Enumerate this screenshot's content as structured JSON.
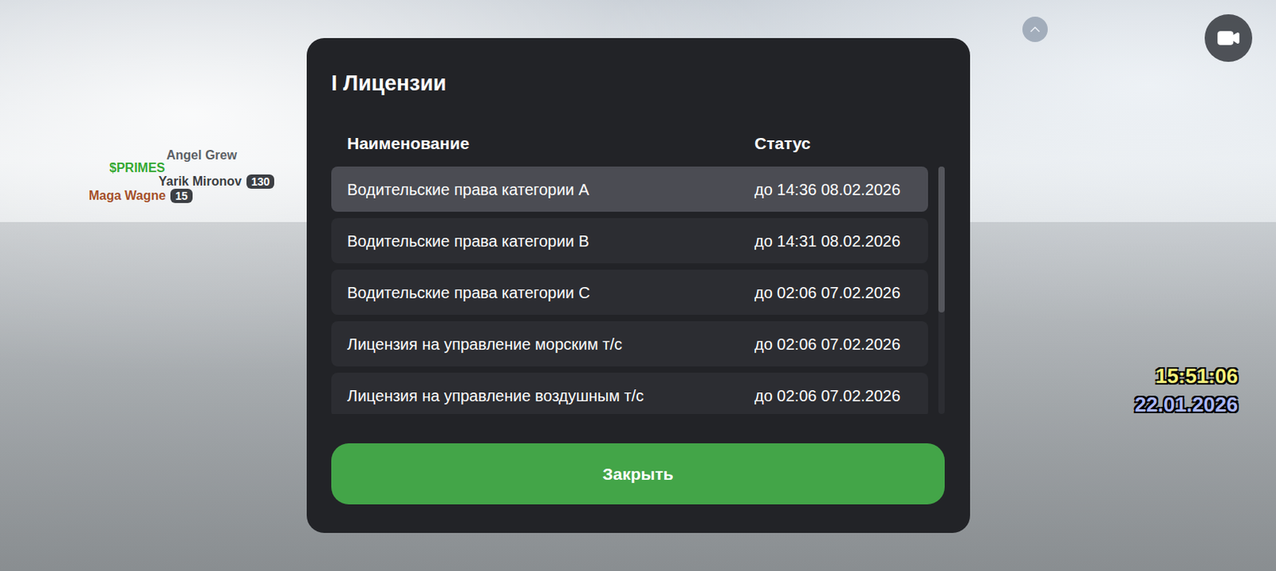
{
  "scene": {
    "nameplates": [
      {
        "name": "Angel Grew",
        "color": "#5c6166"
      },
      {
        "name": "$PRIMES",
        "color": "#35a832"
      },
      {
        "name": "Yarik Mironov",
        "color": "#3b3e42",
        "badge": "130"
      },
      {
        "name": "Maga Wagne",
        "color": "#a4502a",
        "badge": "15"
      }
    ],
    "clock": {
      "time": "15:51:06",
      "date": "22.01.2026"
    }
  },
  "dialog": {
    "title": "I Лицензии",
    "columns": [
      "Наименование",
      "Статус"
    ],
    "rows": [
      {
        "name": "Водительские права категории A",
        "status": "до 14:36 08.02.2026",
        "selected": true
      },
      {
        "name": "Водительские права категории B",
        "status": "до 14:31 08.02.2026",
        "selected": false
      },
      {
        "name": "Водительские права категории C",
        "status": "до 02:06 07.02.2026",
        "selected": false
      },
      {
        "name": "Лицензия на управление морским т/с",
        "status": "до 02:06 07.02.2026",
        "selected": false
      },
      {
        "name": "Лицензия на управление воздушным т/с",
        "status": "до 02:06 07.02.2026",
        "selected": false
      }
    ],
    "scrollbar": {
      "level": 0.59
    },
    "buttons": [
      "Закрыть"
    ]
  }
}
